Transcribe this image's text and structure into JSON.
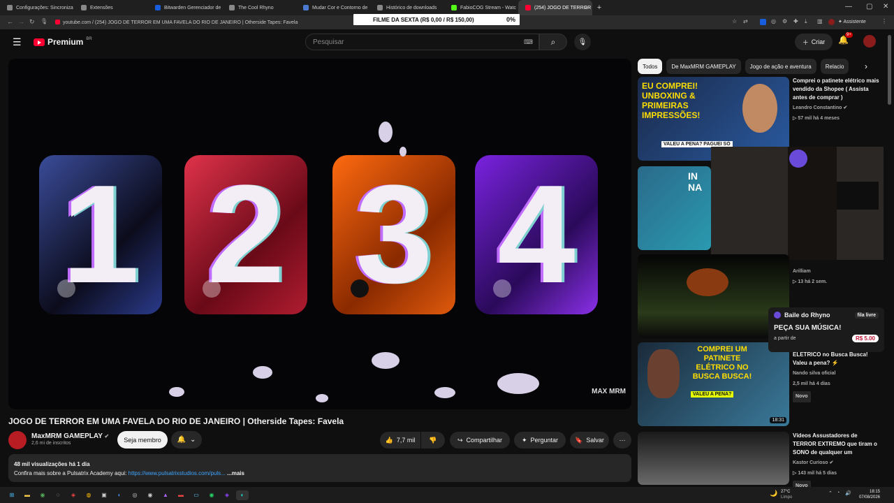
{
  "browser": {
    "tabs": [
      {
        "label": "Configurações: Sincroniza",
        "icon": "gear-icon"
      },
      {
        "label": "Extensões",
        "icon": "puzzle-icon"
      },
      {
        "label": "Bitwarden Gerenciador de",
        "icon": "shield-icon"
      },
      {
        "label": "The Cool Rhyno",
        "icon": "page-icon"
      },
      {
        "label": "Mudar Cor e Contorno de",
        "icon": "page-icon"
      },
      {
        "label": "Histórico de downloads",
        "icon": "download-icon"
      },
      {
        "label": "FabioCOG Stream - Watc",
        "icon": "page-icon"
      },
      {
        "label": "(254) JOGO DE TERROR",
        "icon": "youtube-icon"
      }
    ],
    "new_tab": "+",
    "address": "youtube.com / (254) JOGO DE TERROR EM UMA FAVELA DO RIO DE JANEIRO | Otherside Tapes: Favela",
    "assistant": "Assistente"
  },
  "stream_banner": {
    "label": "FILME DA SEXTA (R$ 0,00 / R$ 150,00)",
    "percent": "0%"
  },
  "youtube": {
    "logo": "Premium",
    "region": "BR",
    "search_placeholder": "Pesquisar",
    "create_label": "Criar",
    "notification_count": "9+"
  },
  "video": {
    "numbers": [
      "1",
      "2",
      "3",
      "4"
    ],
    "watermark": "MAX MRM",
    "title": "JOGO DE TERROR EM UMA FAVELA DO RIO DE JANEIRO | Otherside Tapes: Favela",
    "channel": "MaxMRM GAMEPLAY",
    "subscribers": "2,6 mi de inscritos",
    "join_label": "Seja membro",
    "likes": "7,7 mil",
    "share_label": "Compartilhar",
    "ask_label": "Perguntar",
    "save_label": "Salvar",
    "views": "48 mil visualizações",
    "age": "há 1 dia",
    "desc_text": "Confira mais sobre a Pulsatrix Academy aqui:",
    "desc_link": "https://www.pulsatrixstudios.com/puls...",
    "more": "...mais"
  },
  "chips": [
    "Todos",
    "De MaxMRM GAMEPLAY",
    "Jogo de ação e aventura",
    "Relacio"
  ],
  "recommendations": [
    {
      "title": "Comprei o patinete elétrico mais vendido da Shopee ( Assista antes de comprar )",
      "channel": "Leandro Constantino",
      "views": "57 mil",
      "age": "há 4 meses",
      "thumb_text": "EU COMPREI! UNBOXING & PRIMEIRAS IMPRESSÕES!",
      "thumb_sub": "VALEU A PENA? PAGUEI SÓ"
    },
    {
      "title": "",
      "channel": "",
      "views": "",
      "age": "",
      "thumb_text": "IN NA"
    },
    {
      "title": "",
      "channel": "Arilliam",
      "views": "13",
      "age": "há 2 sem.",
      "thumb_text": ""
    },
    {
      "title": "COMPREI um PATINETE ELÉTRICO no Busca Busca! Valeu a pena? ⚡",
      "channel": "Nando silva oficial",
      "views": "2,5 mil",
      "age": "há 4 dias",
      "badge": "Novo",
      "duration": "18:31",
      "thumb_text": "COMPREI UM PATINETE ELÉTRICO NO BUSCA BUSCA!",
      "thumb_sub": "VALEU A PENA?"
    },
    {
      "title": "Vídeos Assustadores de TERROR EXTREMO que tiram o SONO de qualquer um",
      "channel": "Kastor Curioso",
      "views": "143 mil",
      "age": "há 5 dias",
      "badge": "Novo"
    }
  ],
  "overlay": {
    "name": "Baile do Rhyno",
    "status": "fila livre",
    "cta": "PEÇA SUA MÚSICA!",
    "price_prefix": "a partir de",
    "price": "R$ 5.00"
  },
  "taskbar": {
    "weather": "27°C",
    "weather_desc": "Limpo",
    "time": "18:15",
    "date": "07/08/2026"
  }
}
